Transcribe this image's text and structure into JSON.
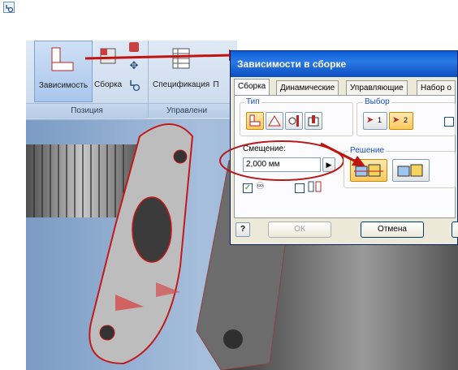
{
  "ribbon": {
    "constraint_label": "Зависимость",
    "assembly_label": "Сборка",
    "specification_label": "Спецификация",
    "specification_label_cut": "П",
    "group_position": "Позиция",
    "group_manage": "Управлени"
  },
  "dialog": {
    "title": "Зависимости в сборке",
    "tabs": [
      "Сборка",
      "Динамические",
      "Управляющие",
      "Набор о"
    ],
    "type_legend": "Тип",
    "selection_legend": "Выбор",
    "selection_1": "1",
    "selection_2": "2",
    "offset_label": "Смещение:",
    "offset_value": "2,000 мм",
    "solution_legend": "Решение",
    "ok_label": "ОК",
    "cancel_label": "Отмена"
  },
  "colors": {
    "arrow_red": "#c2140e",
    "highlight_ellipse": "#b8191a",
    "title_bar": "#0a5fd8"
  }
}
